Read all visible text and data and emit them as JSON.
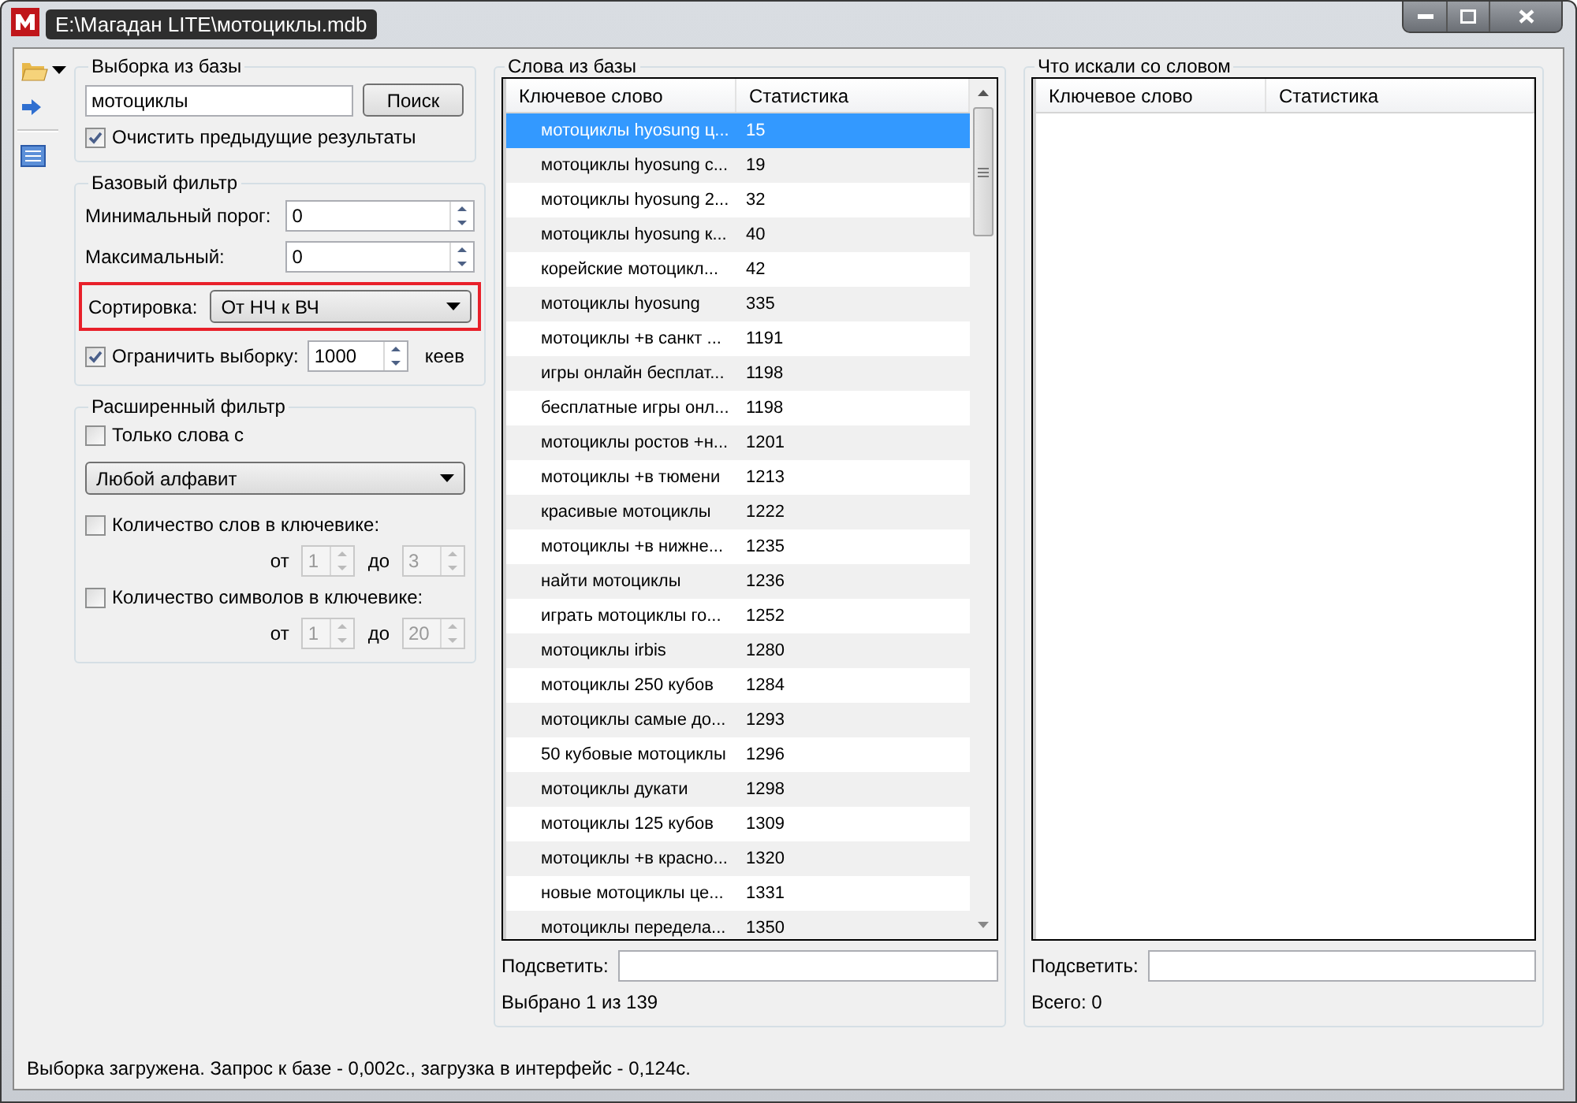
{
  "window": {
    "title": "E:\\Магадан LITE\\мотоциклы.mdb"
  },
  "search_group": {
    "title": "Выборка из базы",
    "query": "мотоциклы",
    "button": "Поиск",
    "clear": {
      "label": "Очистить предыдущие результаты",
      "checked": true
    }
  },
  "basic_filter": {
    "title": "Базовый фильтр",
    "min": {
      "label": "Минимальный порог:",
      "value": "0"
    },
    "max": {
      "label": "Максимальный:",
      "value": "0"
    },
    "sort": {
      "label": "Сортировка:",
      "value": "От НЧ к ВЧ",
      "highlighted": true
    },
    "limit": {
      "label": "Ограничить выборку:",
      "checked": true,
      "value": "1000",
      "unit": "кеев"
    }
  },
  "advanced_filter": {
    "title": "Расширенный фильтр",
    "only_words": {
      "label": "Только слова с",
      "checked": false
    },
    "alphabet": "Любой алфавит",
    "counts": [
      {
        "label": "Количество слов в ключевике:",
        "checked": false,
        "from_label": "от",
        "from": "1",
        "to_label": "до",
        "to": "3"
      },
      {
        "label": "Количество символов в ключевике:",
        "checked": false,
        "from_label": "от",
        "from": "1",
        "to_label": "до",
        "to": "20"
      }
    ]
  },
  "words": {
    "title": "Слова из базы",
    "columns": [
      "Ключевое слово",
      "Статистика"
    ],
    "rows": [
      {
        "keyword": "мотоциклы hyosung ц...",
        "stat": "15",
        "selected": true
      },
      {
        "keyword": "мотоциклы hyosung с...",
        "stat": "19",
        "selected": false
      },
      {
        "keyword": "мотоциклы hyosung 2...",
        "stat": "32",
        "selected": false
      },
      {
        "keyword": "мотоциклы hyosung к...",
        "stat": "40",
        "selected": false
      },
      {
        "keyword": "корейские мотоцикл...",
        "stat": "42",
        "selected": false
      },
      {
        "keyword": "мотоциклы hyosung",
        "stat": "335",
        "selected": false
      },
      {
        "keyword": "мотоциклы +в санкт ...",
        "stat": "1191",
        "selected": false
      },
      {
        "keyword": "игры онлайн бесплат...",
        "stat": "1198",
        "selected": false
      },
      {
        "keyword": "бесплатные игры онл...",
        "stat": "1198",
        "selected": false
      },
      {
        "keyword": "мотоциклы ростов +н...",
        "stat": "1201",
        "selected": false
      },
      {
        "keyword": "мотоциклы +в тюмени",
        "stat": "1213",
        "selected": false
      },
      {
        "keyword": "красивые мотоциклы",
        "stat": "1222",
        "selected": false
      },
      {
        "keyword": "мотоциклы +в нижне...",
        "stat": "1235",
        "selected": false
      },
      {
        "keyword": "найти мотоциклы",
        "stat": "1236",
        "selected": false
      },
      {
        "keyword": "играть мотоциклы го...",
        "stat": "1252",
        "selected": false
      },
      {
        "keyword": "мотоциклы irbis",
        "stat": "1280",
        "selected": false
      },
      {
        "keyword": "мотоциклы 250 кубов",
        "stat": "1284",
        "selected": false
      },
      {
        "keyword": "мотоциклы самые до...",
        "stat": "1293",
        "selected": false
      },
      {
        "keyword": "50 кубовые мотоциклы",
        "stat": "1296",
        "selected": false
      },
      {
        "keyword": "мотоциклы дукати",
        "stat": "1298",
        "selected": false
      },
      {
        "keyword": "мотоциклы 125 кубов",
        "stat": "1309",
        "selected": false
      },
      {
        "keyword": "мотоциклы +в красно...",
        "stat": "1320",
        "selected": false
      },
      {
        "keyword": "новые мотоциклы це...",
        "stat": "1331",
        "selected": false
      },
      {
        "keyword": "мотоциклы передела...",
        "stat": "1350",
        "selected": false
      }
    ],
    "highlight_label": "Подсветить:",
    "footer": "Выбрано 1 из 139"
  },
  "related": {
    "title": "Что искали со словом",
    "columns": [
      "Ключевое слово",
      "Статистика"
    ],
    "highlight_label": "Подсветить:",
    "footer": "Всего: 0"
  },
  "status_bar": "Выборка загружена. Запрос к базе - 0,002с., загрузка в интерфейс - 0,124с."
}
